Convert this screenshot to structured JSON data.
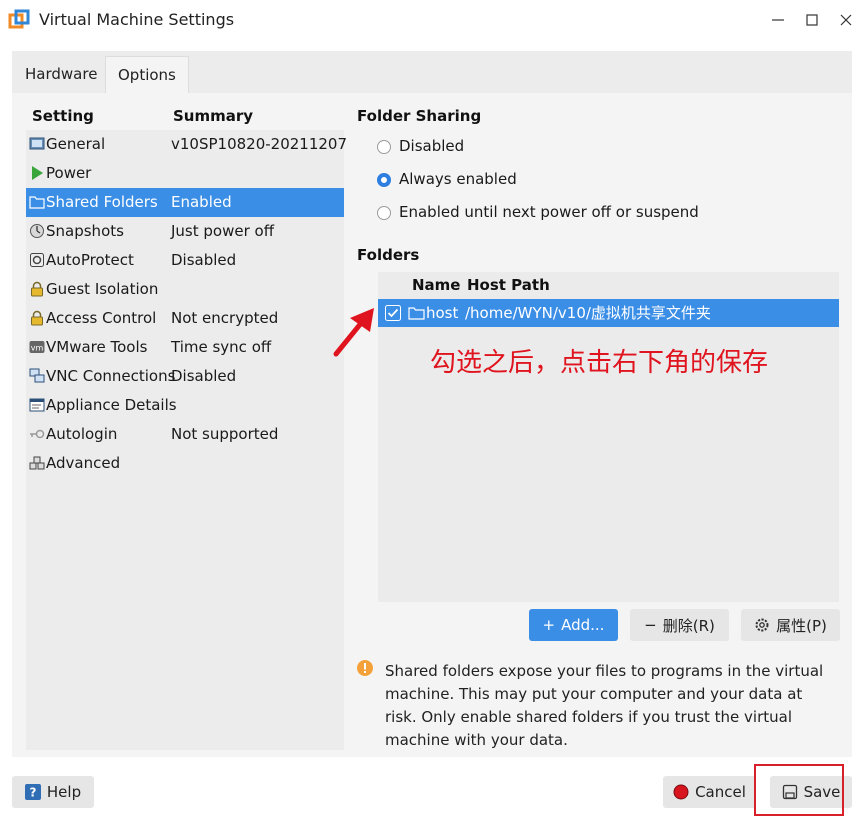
{
  "window": {
    "title": "Virtual Machine Settings",
    "icons": [
      "vmware-app-icon",
      "minimize-icon",
      "maximize-icon",
      "close-icon"
    ]
  },
  "tabs": [
    {
      "label": "Hardware",
      "active": false
    },
    {
      "label": "Options",
      "active": true
    }
  ],
  "settings": {
    "header_setting": "Setting",
    "header_summary": "Summary",
    "items": [
      {
        "name": "General",
        "summary": "v10SP10820-20211207",
        "icon": "general-icon"
      },
      {
        "name": "Power",
        "summary": "",
        "icon": "play-icon"
      },
      {
        "name": "Shared Folders",
        "summary": "Enabled",
        "icon": "folder-icon",
        "selected": true
      },
      {
        "name": "Snapshots",
        "summary": "Just power off",
        "icon": "snapshot-icon"
      },
      {
        "name": "AutoProtect",
        "summary": "Disabled",
        "icon": "autoprotect-icon"
      },
      {
        "name": "Guest Isolation",
        "summary": "",
        "icon": "lock-icon"
      },
      {
        "name": "Access Control",
        "summary": "Not encrypted",
        "icon": "lock-icon"
      },
      {
        "name": "VMware Tools",
        "summary": "Time sync off",
        "icon": "vm-icon"
      },
      {
        "name": "VNC Connections",
        "summary": "Disabled",
        "icon": "vnc-icon"
      },
      {
        "name": "Appliance Details",
        "summary": "",
        "icon": "appliance-icon"
      },
      {
        "name": "Autologin",
        "summary": "Not supported",
        "icon": "key-icon"
      },
      {
        "name": "Advanced",
        "summary": "",
        "icon": "advanced-icon"
      }
    ]
  },
  "folder_sharing": {
    "title": "Folder Sharing",
    "options": [
      {
        "label": "Disabled",
        "checked": false
      },
      {
        "label": "Always enabled",
        "checked": true
      },
      {
        "label": "Enabled until next power off or suspend",
        "checked": false
      }
    ]
  },
  "folders": {
    "title": "Folders",
    "col_name": "Name",
    "col_path": "Host Path",
    "rows": [
      {
        "name": "host",
        "path": "/home/WYN/v10/虚拟机共享文件夹",
        "checked": true
      }
    ]
  },
  "annotation": {
    "text": "勾选之后，点击右下角的保存",
    "color": "#e0141e"
  },
  "folder_buttons": {
    "add": "Add...",
    "remove": "删除(R)",
    "properties": "属性(P)"
  },
  "warning": {
    "text": "Shared folders expose your files to programs in the virtual machine. This may put your computer and your data at risk. Only enable shared folders if you trust the virtual machine with your data.",
    "icon": "warning-icon"
  },
  "footer": {
    "help": "Help",
    "cancel": "Cancel",
    "save": "Save"
  },
  "colors": {
    "accent": "#3b8ee6",
    "warning": "#f4a13a",
    "annotation": "#e0141e"
  }
}
